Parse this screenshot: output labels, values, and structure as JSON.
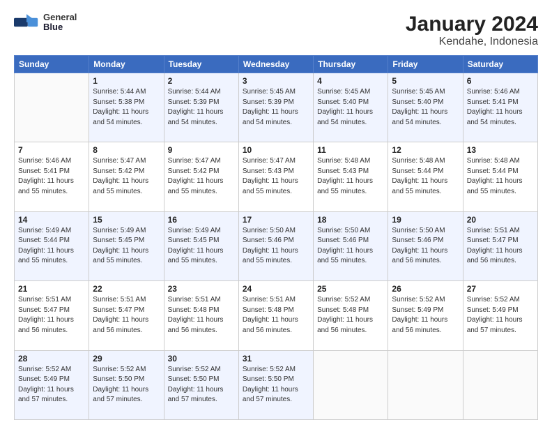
{
  "header": {
    "title": "January 2024",
    "subtitle": "Kendahe, Indonesia",
    "logo_line1": "General",
    "logo_line2": "Blue"
  },
  "weekdays": [
    "Sunday",
    "Monday",
    "Tuesday",
    "Wednesday",
    "Thursday",
    "Friday",
    "Saturday"
  ],
  "weeks": [
    [
      {
        "day": "",
        "info": ""
      },
      {
        "day": "1",
        "info": "Sunrise: 5:44 AM\nSunset: 5:38 PM\nDaylight: 11 hours\nand 54 minutes."
      },
      {
        "day": "2",
        "info": "Sunrise: 5:44 AM\nSunset: 5:39 PM\nDaylight: 11 hours\nand 54 minutes."
      },
      {
        "day": "3",
        "info": "Sunrise: 5:45 AM\nSunset: 5:39 PM\nDaylight: 11 hours\nand 54 minutes."
      },
      {
        "day": "4",
        "info": "Sunrise: 5:45 AM\nSunset: 5:40 PM\nDaylight: 11 hours\nand 54 minutes."
      },
      {
        "day": "5",
        "info": "Sunrise: 5:45 AM\nSunset: 5:40 PM\nDaylight: 11 hours\nand 54 minutes."
      },
      {
        "day": "6",
        "info": "Sunrise: 5:46 AM\nSunset: 5:41 PM\nDaylight: 11 hours\nand 54 minutes."
      }
    ],
    [
      {
        "day": "7",
        "info": "Sunrise: 5:46 AM\nSunset: 5:41 PM\nDaylight: 11 hours\nand 55 minutes."
      },
      {
        "day": "8",
        "info": "Sunrise: 5:47 AM\nSunset: 5:42 PM\nDaylight: 11 hours\nand 55 minutes."
      },
      {
        "day": "9",
        "info": "Sunrise: 5:47 AM\nSunset: 5:42 PM\nDaylight: 11 hours\nand 55 minutes."
      },
      {
        "day": "10",
        "info": "Sunrise: 5:47 AM\nSunset: 5:43 PM\nDaylight: 11 hours\nand 55 minutes."
      },
      {
        "day": "11",
        "info": "Sunrise: 5:48 AM\nSunset: 5:43 PM\nDaylight: 11 hours\nand 55 minutes."
      },
      {
        "day": "12",
        "info": "Sunrise: 5:48 AM\nSunset: 5:44 PM\nDaylight: 11 hours\nand 55 minutes."
      },
      {
        "day": "13",
        "info": "Sunrise: 5:48 AM\nSunset: 5:44 PM\nDaylight: 11 hours\nand 55 minutes."
      }
    ],
    [
      {
        "day": "14",
        "info": "Sunrise: 5:49 AM\nSunset: 5:44 PM\nDaylight: 11 hours\nand 55 minutes."
      },
      {
        "day": "15",
        "info": "Sunrise: 5:49 AM\nSunset: 5:45 PM\nDaylight: 11 hours\nand 55 minutes."
      },
      {
        "day": "16",
        "info": "Sunrise: 5:49 AM\nSunset: 5:45 PM\nDaylight: 11 hours\nand 55 minutes."
      },
      {
        "day": "17",
        "info": "Sunrise: 5:50 AM\nSunset: 5:46 PM\nDaylight: 11 hours\nand 55 minutes."
      },
      {
        "day": "18",
        "info": "Sunrise: 5:50 AM\nSunset: 5:46 PM\nDaylight: 11 hours\nand 55 minutes."
      },
      {
        "day": "19",
        "info": "Sunrise: 5:50 AM\nSunset: 5:46 PM\nDaylight: 11 hours\nand 56 minutes."
      },
      {
        "day": "20",
        "info": "Sunrise: 5:51 AM\nSunset: 5:47 PM\nDaylight: 11 hours\nand 56 minutes."
      }
    ],
    [
      {
        "day": "21",
        "info": "Sunrise: 5:51 AM\nSunset: 5:47 PM\nDaylight: 11 hours\nand 56 minutes."
      },
      {
        "day": "22",
        "info": "Sunrise: 5:51 AM\nSunset: 5:47 PM\nDaylight: 11 hours\nand 56 minutes."
      },
      {
        "day": "23",
        "info": "Sunrise: 5:51 AM\nSunset: 5:48 PM\nDaylight: 11 hours\nand 56 minutes."
      },
      {
        "day": "24",
        "info": "Sunrise: 5:51 AM\nSunset: 5:48 PM\nDaylight: 11 hours\nand 56 minutes."
      },
      {
        "day": "25",
        "info": "Sunrise: 5:52 AM\nSunset: 5:48 PM\nDaylight: 11 hours\nand 56 minutes."
      },
      {
        "day": "26",
        "info": "Sunrise: 5:52 AM\nSunset: 5:49 PM\nDaylight: 11 hours\nand 56 minutes."
      },
      {
        "day": "27",
        "info": "Sunrise: 5:52 AM\nSunset: 5:49 PM\nDaylight: 11 hours\nand 57 minutes."
      }
    ],
    [
      {
        "day": "28",
        "info": "Sunrise: 5:52 AM\nSunset: 5:49 PM\nDaylight: 11 hours\nand 57 minutes."
      },
      {
        "day": "29",
        "info": "Sunrise: 5:52 AM\nSunset: 5:50 PM\nDaylight: 11 hours\nand 57 minutes."
      },
      {
        "day": "30",
        "info": "Sunrise: 5:52 AM\nSunset: 5:50 PM\nDaylight: 11 hours\nand 57 minutes."
      },
      {
        "day": "31",
        "info": "Sunrise: 5:52 AM\nSunset: 5:50 PM\nDaylight: 11 hours\nand 57 minutes."
      },
      {
        "day": "",
        "info": ""
      },
      {
        "day": "",
        "info": ""
      },
      {
        "day": "",
        "info": ""
      }
    ]
  ],
  "row_colors": [
    "#f0f4ff",
    "#ffffff",
    "#f0f4ff",
    "#ffffff",
    "#f0f4ff"
  ]
}
